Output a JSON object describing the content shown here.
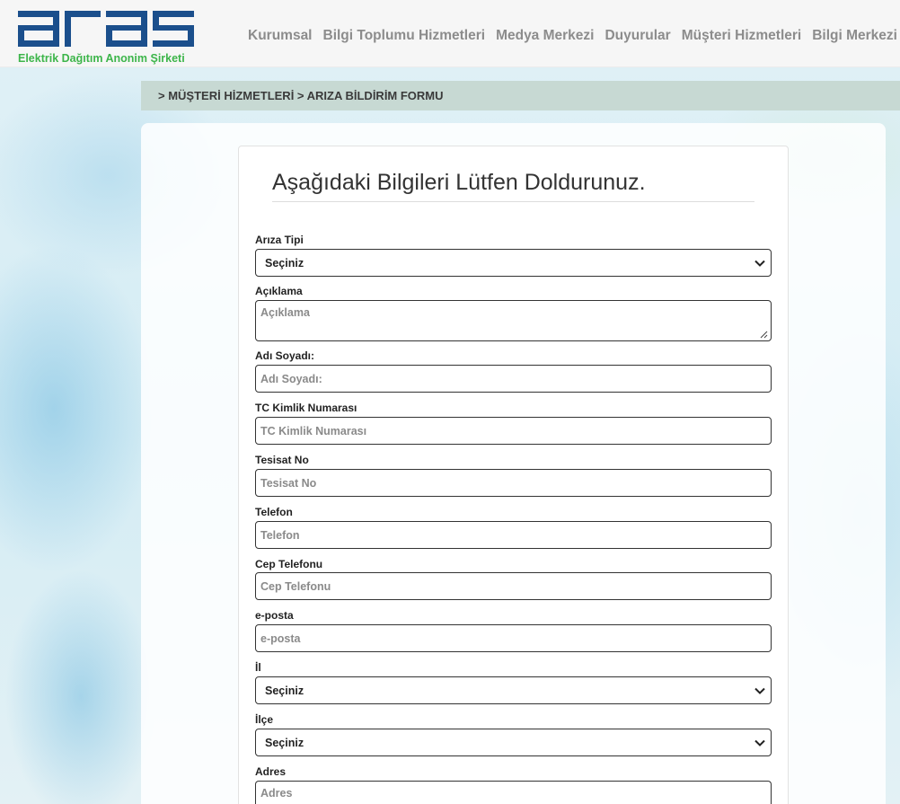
{
  "header": {
    "logo_tagline": "Elektrik Dağıtım Anonim Şirketi",
    "nav": [
      "Kurumsal",
      "Bilgi Toplumu Hizmetleri",
      "Medya Merkezi",
      "Duyurular",
      "Müşteri Hizmetleri",
      "Bilgi Merkezi"
    ]
  },
  "breadcrumb": "> MÜŞTERİ HİZMETLERİ > ARIZA BİLDİRİM FORMU",
  "form": {
    "title": "Aşağıdaki Bilgileri Lütfen Doldurunuz.",
    "ariza_tipi": {
      "label": "Arıza Tipi",
      "value": "Seçiniz"
    },
    "aciklama": {
      "label": "Açıklama",
      "placeholder": "Açıklama"
    },
    "adi_soyadi": {
      "label": "Adı Soyadı:",
      "placeholder": "Adı Soyadı:"
    },
    "tc_kimlik": {
      "label": "TC Kimlik Numarası",
      "placeholder": "TC Kimlik Numarası"
    },
    "tesisat_no": {
      "label": "Tesisat No",
      "placeholder": "Tesisat No"
    },
    "telefon": {
      "label": "Telefon",
      "placeholder": "Telefon"
    },
    "cep_telefonu": {
      "label": "Cep Telefonu",
      "placeholder": "Cep Telefonu"
    },
    "eposta": {
      "label": "e-posta",
      "placeholder": "e-posta"
    },
    "il": {
      "label": "İl",
      "value": "Seçiniz"
    },
    "ilce": {
      "label": "İlçe",
      "value": "Seçiniz"
    },
    "adres": {
      "label": "Adres",
      "placeholder": "Adres"
    }
  },
  "colors": {
    "logo_blue": "#1b4f8c",
    "tagline_green": "#3db54a",
    "nav_gray": "#8c8c8c",
    "breadcrumb_bg": "#c7d9d3"
  }
}
